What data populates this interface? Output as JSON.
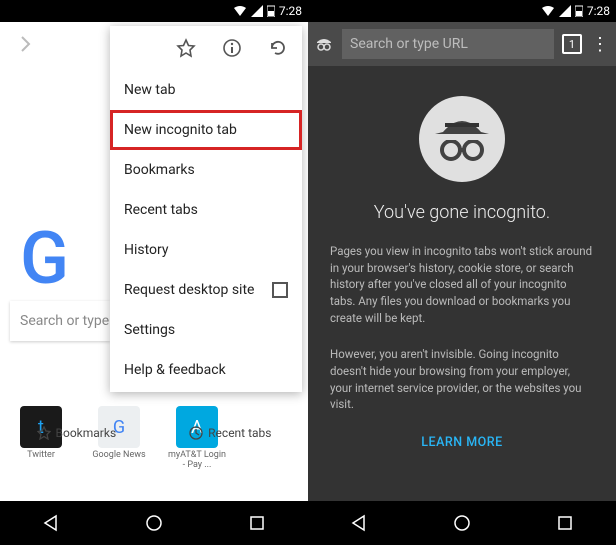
{
  "status": {
    "time": "7:28"
  },
  "left": {
    "menu": {
      "items": [
        {
          "label": "New tab",
          "hl": false
        },
        {
          "label": "New incognito tab",
          "hl": true
        },
        {
          "label": "Bookmarks",
          "hl": false
        },
        {
          "label": "Recent tabs",
          "hl": false
        },
        {
          "label": "History",
          "hl": false
        },
        {
          "label": "Request desktop site",
          "hl": false,
          "check": true
        },
        {
          "label": "Settings",
          "hl": false
        },
        {
          "label": "Help & feedback",
          "hl": false
        }
      ]
    },
    "search_placeholder": "Search or type U",
    "shortcuts": [
      {
        "label": "Twitter",
        "bg": "#1a1a1a",
        "fg": "#1DA1F2",
        "glyph": "t"
      },
      {
        "label": "Google News",
        "bg": "#eceff1",
        "fg": "#4285F4",
        "glyph": "G"
      },
      {
        "label": "myAT&T Login - Pay ...",
        "bg": "#00a8e0",
        "fg": "#fff",
        "glyph": "A"
      }
    ],
    "bottom": {
      "bookmarks": "Bookmarks",
      "recent": "Recent tabs"
    }
  },
  "right": {
    "url_placeholder": "Search or type URL",
    "tab_count": "1",
    "title": "You've gone incognito.",
    "p1": "Pages you view in incognito tabs won't stick around in your browser's history, cookie store, or search history after you've closed all of your incognito tabs. Any files you download or bookmarks you create will be kept.",
    "p2": "However, you aren't invisible. Going incognito doesn't hide your browsing from your employer, your internet service provider, or the websites you visit.",
    "learn": "LEARN MORE"
  }
}
